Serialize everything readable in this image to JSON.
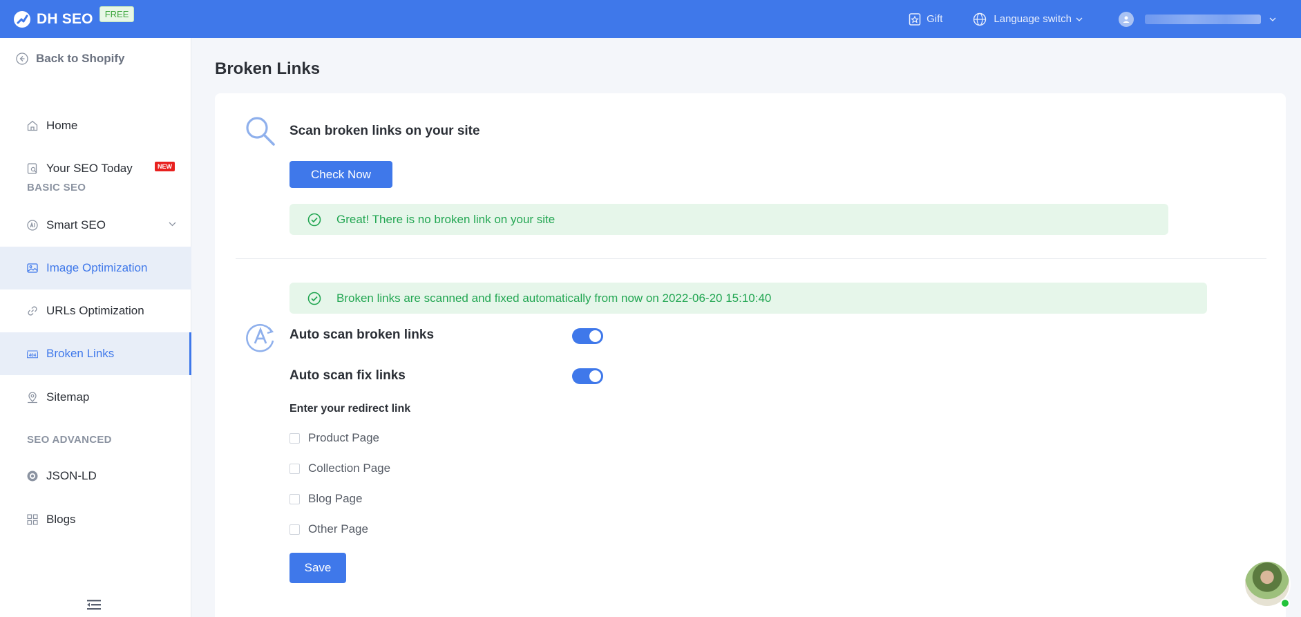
{
  "header": {
    "brand": "DH SEO",
    "plan_badge": "FREE",
    "gift_label": "Gift",
    "language_label": "Language switch"
  },
  "sidebar": {
    "back_label": "Back to Shopify",
    "items": [
      {
        "label": "Home",
        "icon": "home-icon"
      },
      {
        "label": "Your SEO Today",
        "icon": "seo-report-icon",
        "badge": "NEW"
      },
      {
        "label": "Smart SEO",
        "icon": "ai-icon"
      },
      {
        "label": "Image Optimization",
        "icon": "image-icon"
      },
      {
        "label": "URLs Optimization",
        "icon": "link-icon"
      },
      {
        "label": "Broken Links",
        "icon": "404-icon"
      },
      {
        "label": "Sitemap",
        "icon": "map-pin-icon"
      },
      {
        "label": "JSON-LD",
        "icon": "json-ld-icon"
      },
      {
        "label": "Blogs",
        "icon": "blogs-icon"
      }
    ],
    "sections": {
      "basic": "BASIC SEO",
      "advanced": "SEO ADVANCED"
    }
  },
  "main": {
    "page_title": "Broken Links",
    "scan": {
      "title": "Scan broken links on your site",
      "button": "Check Now",
      "result": "Great! There is no broken link on your site"
    },
    "auto": {
      "status": "Broken links are scanned and fixed automatically from now on 2022-06-20 15:10:40",
      "auto_scan_label": "Auto scan broken links",
      "auto_scan_on": true,
      "auto_fix_label": "Auto scan fix links",
      "auto_fix_on": true,
      "redirect_label": "Enter your redirect link",
      "options": [
        "Product Page",
        "Collection Page",
        "Blog Page",
        "Other Page"
      ],
      "save_button": "Save"
    }
  },
  "colors": {
    "primary": "#3f78ea",
    "success": "#22a652",
    "success_bg": "#e6f6ea",
    "badge_red": "#e8201e"
  }
}
